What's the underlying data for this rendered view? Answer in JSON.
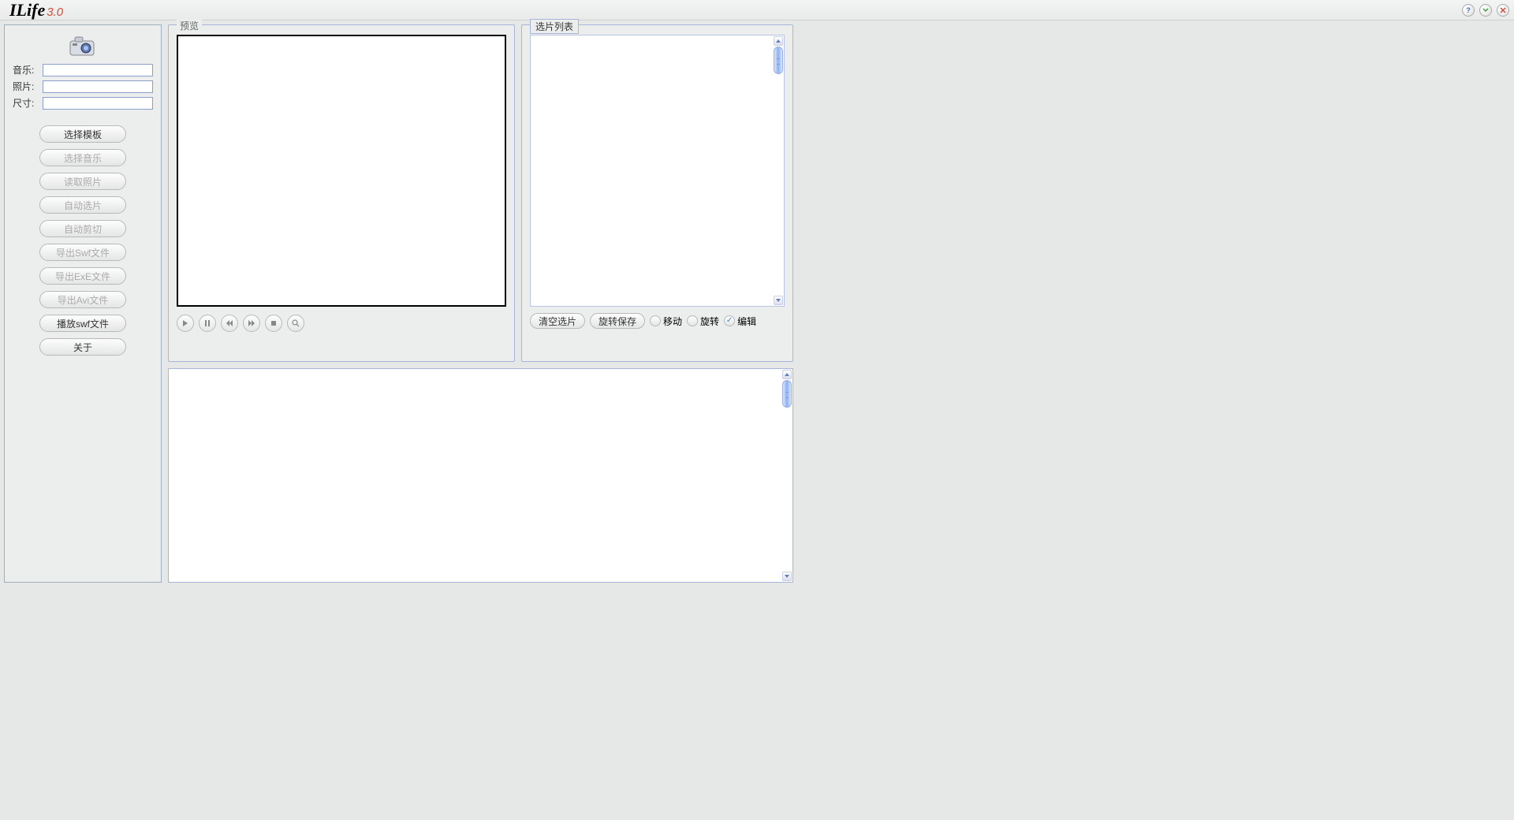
{
  "app": {
    "name": "ILife",
    "version": "3.0"
  },
  "sidebar": {
    "labels": {
      "music": "音乐:",
      "photo": "照片:",
      "size": "尺寸:"
    },
    "fields": {
      "music": "",
      "photo": "",
      "size": ""
    },
    "buttons": [
      {
        "label": "选择模板",
        "enabled": true
      },
      {
        "label": "选择音乐",
        "enabled": false
      },
      {
        "label": "读取照片",
        "enabled": false
      },
      {
        "label": "自动选片",
        "enabled": false
      },
      {
        "label": "自动剪切",
        "enabled": false
      },
      {
        "label": "导出Swf文件",
        "enabled": false
      },
      {
        "label": "导出ExE文件",
        "enabled": false
      },
      {
        "label": "导出Avi文件",
        "enabled": false
      },
      {
        "label": "播放swf文件",
        "enabled": true
      },
      {
        "label": "关于",
        "enabled": true
      }
    ]
  },
  "preview": {
    "title": "预览"
  },
  "selection": {
    "title": "选片列表",
    "clear": "清空选片",
    "rotate_save": "旋转保存",
    "radios": {
      "move": "移动",
      "rotate": "旋转",
      "edit": "编辑",
      "selected": "edit"
    }
  }
}
